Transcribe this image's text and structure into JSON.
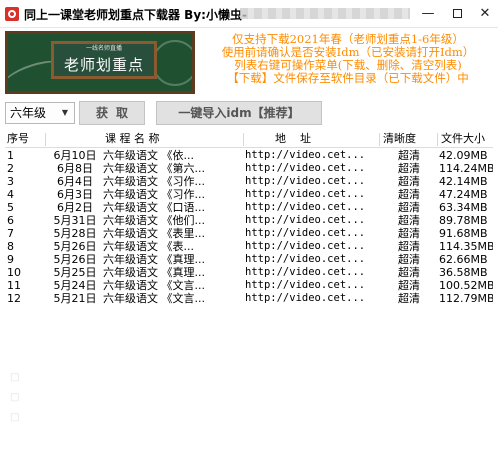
{
  "window": {
    "title": "同上一课堂老师划重点下载器 By:小懒虫-",
    "controls": {
      "minimize": "—",
      "maximize": "",
      "close": "✕"
    }
  },
  "banner": {
    "caption": "一线名师直播",
    "title": "老师划重点"
  },
  "info_lines": [
    "仅支持下载2021年春（老师划重点1-6年级）",
    "使用前请确认是否安装Idm（已安装请打开Idm）",
    "列表右键可操作菜单(下载、删除、清空列表)",
    "【下载】文件保存至软件目录（已下载文件）中"
  ],
  "toolbar": {
    "grade_value": "六年级",
    "grade_arrow": "▼",
    "fetch_button": "获取",
    "import_button": "一键导入idm【推荐】"
  },
  "table": {
    "columns": [
      "序号",
      "课 程 名 称",
      "地    址",
      "清晰度",
      "文件大小"
    ],
    "rows": [
      {
        "no": "1",
        "date": "6月10日",
        "name": "六年级语文 《依...",
        "url": "http://video.cet...",
        "clarity": "超清",
        "size": "42.09MB"
      },
      {
        "no": "2",
        "date": "6月8日",
        "name": "六年级语文 《第六...",
        "url": "http://video.cet...",
        "clarity": "超清",
        "size": "114.24MB"
      },
      {
        "no": "3",
        "date": "6月4日",
        "name": "六年级语文 《习作...",
        "url": "http://video.cet...",
        "clarity": "超清",
        "size": "42.14MB"
      },
      {
        "no": "4",
        "date": "6月3日",
        "name": "六年级语文 《习作...",
        "url": "http://video.cet...",
        "clarity": "超清",
        "size": "47.24MB"
      },
      {
        "no": "5",
        "date": "6月2日",
        "name": "六年级语文 《口语...",
        "url": "http://video.cet...",
        "clarity": "超清",
        "size": "63.34MB"
      },
      {
        "no": "6",
        "date": "5月31日",
        "name": "六年级语文 《他们...",
        "url": "http://video.cet...",
        "clarity": "超清",
        "size": "89.78MB"
      },
      {
        "no": "7",
        "date": "5月28日",
        "name": "六年级语文 《表里...",
        "url": "http://video.cet...",
        "clarity": "超清",
        "size": "91.68MB"
      },
      {
        "no": "8",
        "date": "5月26日",
        "name": "六年级语文 《表...",
        "url": "http://video.cet...",
        "clarity": "超清",
        "size": "114.35MB"
      },
      {
        "no": "9",
        "date": "5月26日",
        "name": "六年级语文 《真理...",
        "url": "http://video.cet...",
        "clarity": "超清",
        "size": "62.66MB"
      },
      {
        "no": "10",
        "date": "5月25日",
        "name": "六年级语文 《真理...",
        "url": "http://video.cet...",
        "clarity": "超清",
        "size": "36.58MB"
      },
      {
        "no": "11",
        "date": "5月24日",
        "name": "六年级语文 《文言...",
        "url": "http://video.cet...",
        "clarity": "超清",
        "size": "100.52MB"
      },
      {
        "no": "12",
        "date": "5月21日",
        "name": "六年级语文 《文言...",
        "url": "http://video.cet...",
        "clarity": "超清",
        "size": "112.79MB"
      }
    ]
  },
  "colors": {
    "info_text": "#ff8c00",
    "banner_bg": "#1f5130",
    "banner_frame": "#5e3a1e",
    "button_bg": "#e1e1e1"
  }
}
